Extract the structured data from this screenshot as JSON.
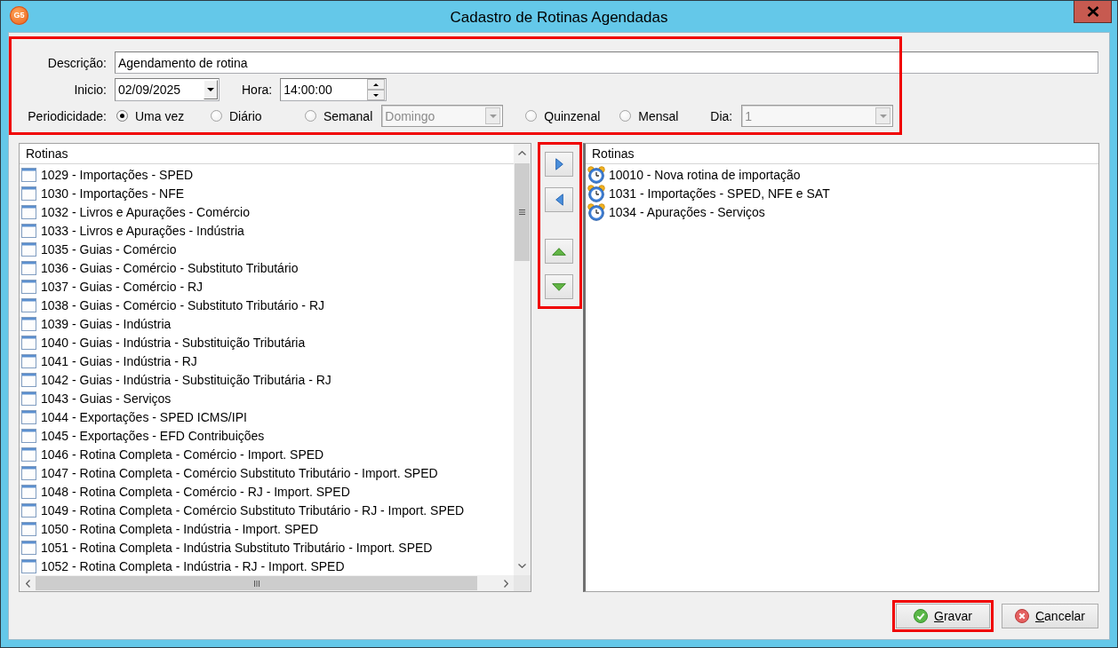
{
  "window": {
    "title": "Cadastro de Rotinas Agendadas",
    "logo_text": "G5"
  },
  "form": {
    "highlighted": true,
    "description": {
      "label": "Descrição:",
      "value": "Agendamento de rotina"
    },
    "start_date": {
      "label": "Inicio:",
      "value": "02/09/2025"
    },
    "time": {
      "label": "Hora:",
      "value": "14:00:00"
    },
    "periodicity": {
      "label": "Periodicidade:",
      "items": [
        {
          "kind": "radio",
          "label": "Uma vez",
          "selected": true
        },
        {
          "kind": "radio",
          "label": "Diário",
          "selected": false
        },
        {
          "kind": "radio",
          "label": "Semanal",
          "selected": false
        },
        {
          "kind": "combo",
          "value": "Domingo",
          "disabled": true
        },
        {
          "kind": "radio",
          "label": "Quinzenal",
          "selected": false
        },
        {
          "kind": "radio",
          "label": "Mensal",
          "selected": false
        },
        {
          "kind": "label",
          "text": "Dia:"
        },
        {
          "kind": "combo",
          "value": "1",
          "disabled": true
        }
      ]
    }
  },
  "available_list": {
    "header": "Rotinas",
    "rows": [
      {
        "label": "1029 - Importações - SPED",
        "selected": false
      },
      {
        "label": "1030 - Importações - NFE",
        "selected": false
      },
      {
        "label": "1032 - Livros e Apurações - Comércio",
        "selected": false
      },
      {
        "label": "1033 - Livros e Apurações - Indústria",
        "selected": false
      },
      {
        "label": "1035 - Guias - Comércio",
        "selected": false
      },
      {
        "label": "1036 - Guias - Comércio - Substituto Tributário",
        "selected": false
      },
      {
        "label": "1037 - Guias - Comércio - RJ",
        "selected": false
      },
      {
        "label": "1038 - Guias - Comércio - Substituto Tributário - RJ",
        "selected": false
      },
      {
        "label": "1039 - Guias - Indústria",
        "selected": false
      },
      {
        "label": "1040 - Guias - Indústria - Substituição Tributária",
        "selected": false
      },
      {
        "label": "1041 - Guias - Indústria - RJ",
        "selected": false
      },
      {
        "label": "1042 - Guias - Indústria - Substituição Tributária - RJ",
        "selected": false
      },
      {
        "label": "1043 - Guias - Serviços",
        "selected": false
      },
      {
        "label": "1044 - Exportações - SPED ICMS/IPI",
        "selected": false
      },
      {
        "label": "1045 - Exportações - EFD Contribuições",
        "selected": false
      },
      {
        "label": "1046 - Rotina Completa - Comércio - Import. SPED",
        "selected": false
      },
      {
        "label": "1047 - Rotina Completa - Comércio Substituto Tributário - Import. SPED",
        "selected": false
      },
      {
        "label": "1048 - Rotina Completa - Comércio - RJ - Import. SPED",
        "selected": false
      },
      {
        "label": "1049 - Rotina Completa - Comércio Substituto Tributário - RJ - Import. SPED",
        "selected": false
      },
      {
        "label": "1050 - Rotina Completa - Indústria - Import. SPED",
        "selected": false
      },
      {
        "label": "1051 - Rotina Completa - Indústria Substituto Tributário - Import. SPED",
        "selected": false
      },
      {
        "label": "1052 - Rotina Completa - Indústria - RJ - Import. SPED",
        "selected": false
      }
    ]
  },
  "transfer_buttons": {
    "highlighted": true
  },
  "selected_list": {
    "header": "Rotinas",
    "rows": [
      {
        "label": "10010 - Nova rotina de importação",
        "selected": false
      },
      {
        "label": "1031 - Importações - SPED, NFE e SAT",
        "selected": false
      },
      {
        "label": "1034 - Apurações - Serviços",
        "selected": false
      }
    ]
  },
  "buttons": [
    {
      "kind": "save",
      "label": "Gravar",
      "underline_first": true,
      "highlighted": true
    },
    {
      "kind": "cancel",
      "label": "Cancelar",
      "underline_first": true,
      "highlighted": false
    }
  ]
}
